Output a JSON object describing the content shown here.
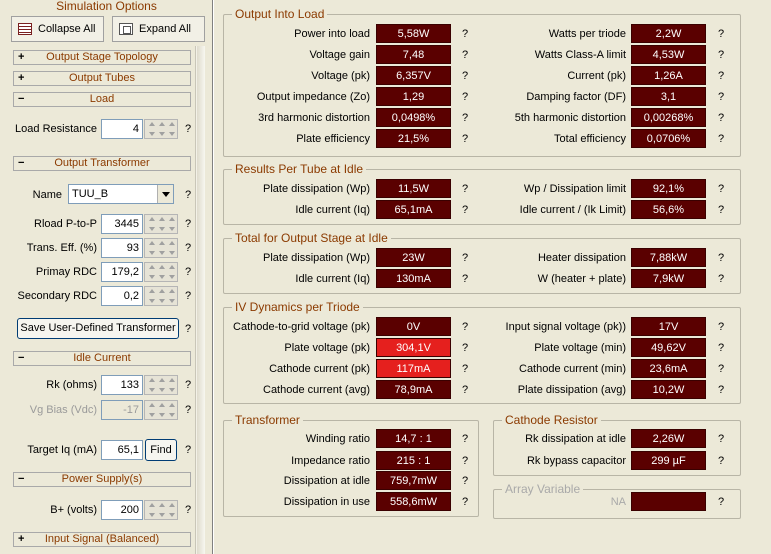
{
  "left": {
    "title": "Simulation Options",
    "collapse_label": "Collapse All",
    "expand_label": "Expand All",
    "sections": {
      "topology": {
        "sign": "+",
        "label": "Output Stage Topology"
      },
      "tubes": {
        "sign": "+",
        "label": "Output Tubes"
      },
      "load": {
        "sign": "−",
        "label": "Load"
      },
      "transformer": {
        "sign": "−",
        "label": "Output Transformer"
      },
      "idle": {
        "sign": "−",
        "label": "Idle Current"
      },
      "psu": {
        "sign": "−",
        "label": "Power Supply(s)"
      },
      "input": {
        "sign": "+",
        "label": "Input Signal (Balanced)"
      }
    },
    "load_resistance": {
      "label": "Load Resistance",
      "value": "4"
    },
    "name": {
      "label": "Name",
      "value": "TUU_B"
    },
    "rload": {
      "label": "Rload P-to-P",
      "value": "3445"
    },
    "trans_eff": {
      "label": "Trans. Eff. (%)",
      "value": "93"
    },
    "primary_rdc": {
      "label": "Primay RDC",
      "value": "179,2"
    },
    "secondary_rdc": {
      "label": "Secondary RDC",
      "value": "0,2"
    },
    "save_button": "Save User-Defined Transformer",
    "rk": {
      "label": "Rk (ohms)",
      "value": "133"
    },
    "vg_bias": {
      "label": "Vg Bias (Vdc)",
      "value": "-17"
    },
    "target_iq": {
      "label": "Target Iq (mA)",
      "value": "65,1"
    },
    "find_button": "Find",
    "bplus": {
      "label": "B+ (volts)",
      "value": "200"
    },
    "q": "?"
  },
  "groups": {
    "output_into_load": {
      "title": "Output Into Load",
      "left": [
        {
          "label": "Power into load",
          "value": "5,58W"
        },
        {
          "label": "Voltage gain",
          "value": "7,48"
        },
        {
          "label": "Voltage (pk)",
          "value": "6,357V"
        },
        {
          "label": "Output impedance (Zo)",
          "value": "1,29"
        },
        {
          "label": "3rd harmonic distortion",
          "value": "0,0498%"
        },
        {
          "label": "Plate efficiency",
          "value": "21,5%"
        }
      ],
      "right": [
        {
          "label": "Watts per triode",
          "value": "2,2W"
        },
        {
          "label": "Watts Class-A limit",
          "value": "4,53W"
        },
        {
          "label": "Current (pk)",
          "value": "1,26A"
        },
        {
          "label": "Damping factor (DF)",
          "value": "3,1"
        },
        {
          "label": "5th harmonic distortion",
          "value": "0,00268%"
        },
        {
          "label": "Total efficiency",
          "value": "0,0706%"
        }
      ]
    },
    "per_tube": {
      "title": "Results Per Tube at Idle",
      "left": [
        {
          "label": "Plate dissipation (Wp)",
          "value": "11,5W"
        },
        {
          "label": "Idle current (Iq)",
          "value": "65,1mA"
        }
      ],
      "right": [
        {
          "label": "Wp / Dissipation limit",
          "value": "92,1%"
        },
        {
          "label": "Idle current / (Ik Limit)",
          "value": "56,6%"
        }
      ]
    },
    "total_stage": {
      "title": "Total for Output Stage at Idle",
      "left": [
        {
          "label": "Plate dissipation (Wp)",
          "value": "23W"
        },
        {
          "label": "Idle current (Iq)",
          "value": "130mA"
        }
      ],
      "right": [
        {
          "label": "Heater dissipation",
          "value": "7,88kW"
        },
        {
          "label": "W (heater + plate)",
          "value": "7,9kW"
        }
      ]
    },
    "iv_dynamics": {
      "title": "IV Dynamics per Triode",
      "left": [
        {
          "label": "Cathode-to-grid voltage (pk)",
          "value": "0V"
        },
        {
          "label": "Plate voltage (pk)",
          "value": "304,1V"
        },
        {
          "label": "Cathode current (pk)",
          "value": "117mA"
        },
        {
          "label": "Cathode current (avg)",
          "value": "78,9mA"
        }
      ],
      "right": [
        {
          "label": "Input signal voltage (pk))",
          "value": "17V"
        },
        {
          "label": "Plate voltage (min)",
          "value": "49,62V"
        },
        {
          "label": "Cathode current (min)",
          "value": "23,6mA"
        },
        {
          "label": "Plate dissipation (avg)",
          "value": "10,2W"
        }
      ]
    },
    "transformer": {
      "title": "Transformer",
      "rows": [
        {
          "label": "Winding ratio",
          "value": "14,7 : 1"
        },
        {
          "label": "Impedance ratio",
          "value": "215 : 1"
        },
        {
          "label": "Dissipation at idle",
          "value": "759,7mW"
        },
        {
          "label": "Dissipation in use",
          "value": "558,6mW"
        }
      ]
    },
    "cathode_resistor": {
      "title": "Cathode Resistor",
      "rows": [
        {
          "label": "Rk dissipation at idle",
          "value": "2,26W"
        },
        {
          "label": "Rk bypass capacitor",
          "value": "299 µF"
        }
      ]
    },
    "array_variable": {
      "title": "Array Variable",
      "label": "NA",
      "value": ""
    }
  },
  "colors": {
    "value_bg": "#5A0000",
    "value_highlight": "#E5201E",
    "accent": "#8B3A00"
  }
}
